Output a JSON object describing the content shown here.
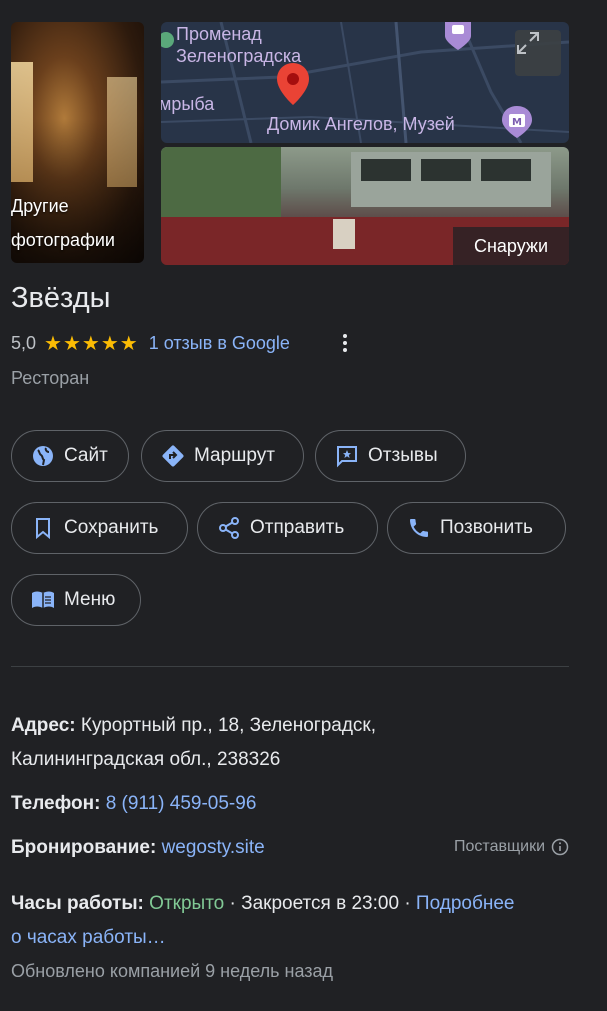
{
  "gallery": {
    "other_photos_label_line1": "Другие",
    "other_photos_label_line2": "фотографии",
    "outside_label": "Снаружи",
    "map_labels": {
      "promenade_line1": "Променад",
      "promenade_line2": "Зеленоградска",
      "partial_label": "мрыба",
      "museum": "Домик Ангелов, Музей"
    }
  },
  "place": {
    "name": "Звёзды",
    "rating": "5,0",
    "stars": "★★★★★",
    "reviews_link": "1 отзыв в Google",
    "category": "Ресторан"
  },
  "actions": {
    "site": "Сайт",
    "route": "Маршрут",
    "reviews": "Отзывы",
    "save": "Сохранить",
    "share": "Отправить",
    "call": "Позвонить",
    "menu": "Меню"
  },
  "info": {
    "address_label": "Адрес:",
    "address_line1": "Курортный пр., 18, Зеленоградск,",
    "address_line2": "Калининградская обл., 238326",
    "phone_label": "Телефон:",
    "phone": "8 (911) 459-05-96",
    "booking_label": "Бронирование:",
    "booking_link": "wegosty.site",
    "providers": "Поставщики",
    "hours_label": "Часы работы:",
    "hours_status": "Открыто",
    "hours_close": " · Закроется в 23:00 · ",
    "hours_more_line1": "Подробнее",
    "hours_more_line2": "о часах работы…",
    "updated": "Обновлено компанией 9 недель назад"
  },
  "colors": {
    "background": "#202124",
    "link": "#8ab4f8",
    "open": "#81c995",
    "star": "#fbbc04",
    "map_pin": "#ea4335"
  }
}
